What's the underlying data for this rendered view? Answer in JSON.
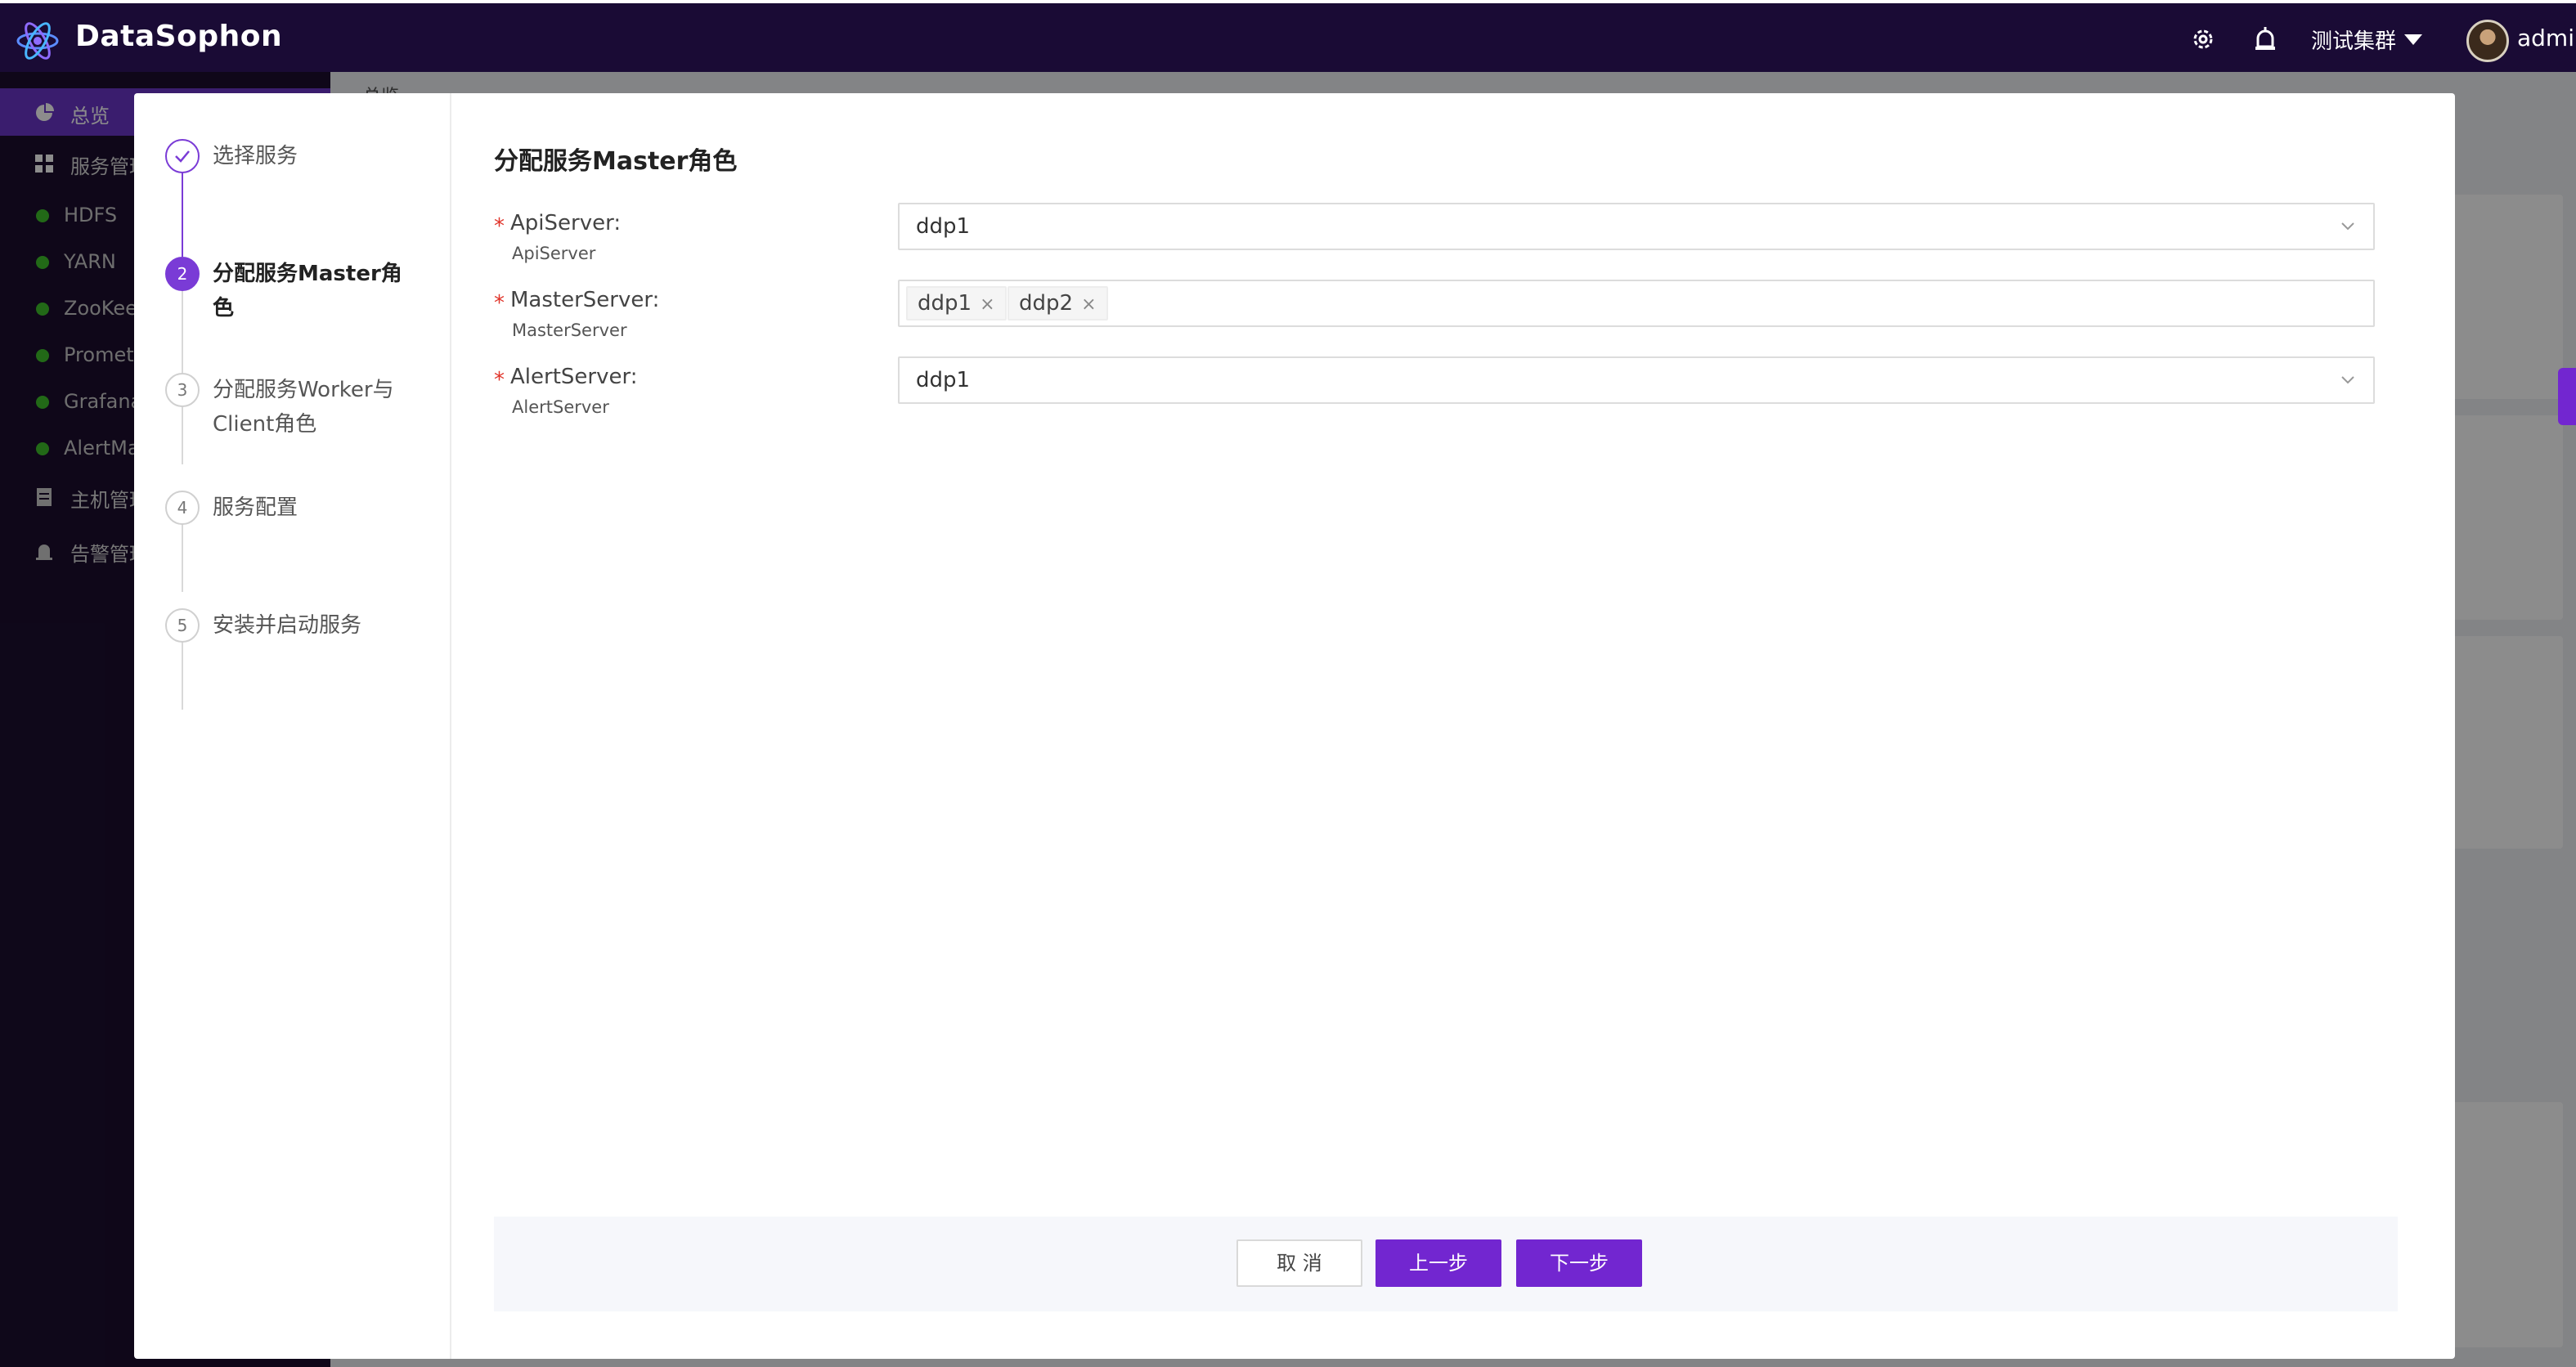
{
  "header": {
    "app_title": "DataSophon",
    "cluster_name": "测试集群",
    "username": "admin"
  },
  "sidebar": {
    "items": [
      {
        "label": "总览",
        "icon": "pie-chart-icon",
        "active": true
      },
      {
        "label": "服务管理",
        "icon": "grid-icon"
      }
    ],
    "services": [
      "HDFS",
      "YARN",
      "ZooKeeper",
      "Prometheus",
      "Grafana",
      "AlertManager"
    ],
    "bottom_items": [
      {
        "label": "主机管理",
        "icon": "server-icon"
      },
      {
        "label": "告警管理",
        "icon": "alarm-icon"
      }
    ]
  },
  "breadcrumb": "总览",
  "wizard": {
    "steps": [
      {
        "num": "1",
        "title": "选择服务",
        "status": "done"
      },
      {
        "num": "2",
        "title": "分配服务Master角色",
        "status": "active"
      },
      {
        "num": "3",
        "title": "分配服务Worker与Client角色",
        "status": "wait"
      },
      {
        "num": "4",
        "title": "服务配置",
        "status": "wait"
      },
      {
        "num": "5",
        "title": "安装并启动服务",
        "status": "wait"
      }
    ],
    "form_title": "分配服务Master角色",
    "fields": [
      {
        "label": "ApiServer:",
        "sublabel": "ApiServer",
        "value": "ddp1",
        "type": "select"
      },
      {
        "label": "MasterServer:",
        "sublabel": "MasterServer",
        "tags": [
          "ddp1",
          "ddp2"
        ],
        "type": "multi-select"
      },
      {
        "label": "AlertServer:",
        "sublabel": "AlertServer",
        "value": "ddp1",
        "type": "select"
      }
    ],
    "buttons": {
      "cancel": "取 消",
      "prev": "上一步",
      "next": "下一步"
    }
  },
  "colors": {
    "accent": "#7226d0",
    "header_bg": "#1a0b35",
    "required": "#e0342a",
    "service_status": "#3fbf2a"
  }
}
